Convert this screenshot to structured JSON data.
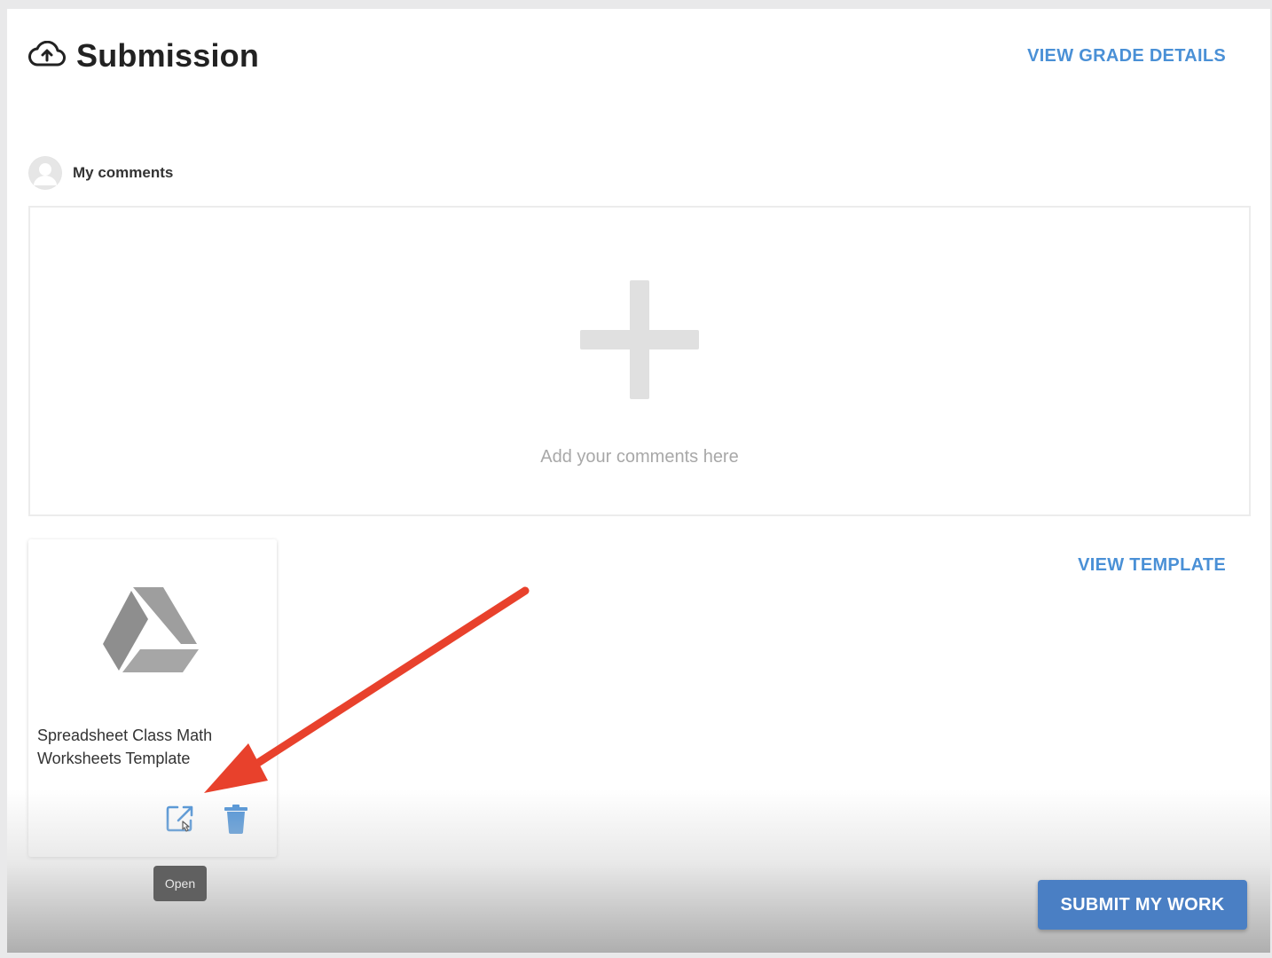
{
  "header": {
    "title": "Submission",
    "icon": "cloud-upload-icon",
    "view_grade_details": "VIEW GRADE DETAILS"
  },
  "comments": {
    "label": "My comments",
    "placeholder": "Add your comments here"
  },
  "attachment": {
    "file_name": "Spreadsheet Class Math Worksheets Template",
    "icon": "google-drive-icon",
    "open_tooltip": "Open"
  },
  "actions": {
    "view_template": "VIEW TEMPLATE",
    "submit": "SUBMIT MY WORK"
  },
  "colors": {
    "link": "#4a90d6",
    "submit_bg": "#4a7fc4",
    "annotation_arrow": "#e8412c",
    "drive_icon": "#9e9e9e"
  }
}
